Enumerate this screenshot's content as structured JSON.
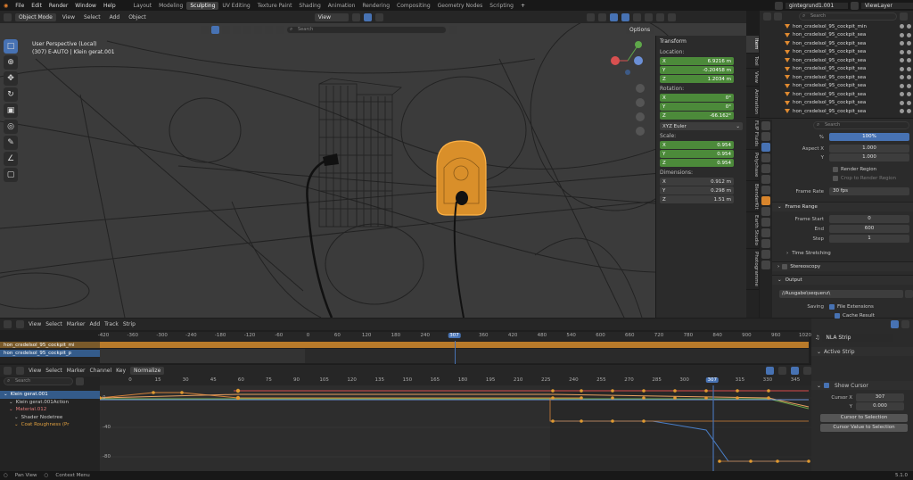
{
  "menu": {
    "items": [
      "File",
      "Edit",
      "Render",
      "Window",
      "Help"
    ],
    "workspaces": [
      "Layout",
      "Modeling",
      "Sculpting",
      "UV Editing",
      "Texture Paint",
      "Shading",
      "Animation",
      "Rendering",
      "Compositing",
      "Geometry Nodes",
      "Scripting"
    ],
    "active_workspace": "Sculpting",
    "scene": "gintegrund1.001",
    "view_layer": "ViewLayer"
  },
  "viewport": {
    "mode": "Object Mode",
    "menus": [
      "View",
      "Select",
      "Add",
      "Object"
    ],
    "orientation": "View",
    "options": "Options",
    "perspective": "User Perspective (Local)",
    "object_info": "(307) E-AUTO | Klein gerat.001",
    "search_placeholder": "Search"
  },
  "transform": {
    "header": "Transform",
    "location_label": "Location:",
    "location": [
      {
        "axis": "X",
        "value": "6.9216 m"
      },
      {
        "axis": "Y",
        "value": "-0.20458 m"
      },
      {
        "axis": "Z",
        "value": "1.2034 m"
      }
    ],
    "rotation_label": "Rotation:",
    "rotation": [
      {
        "axis": "X",
        "value": "0°"
      },
      {
        "axis": "Y",
        "value": "0°"
      },
      {
        "axis": "Z",
        "value": "-66.162°"
      }
    ],
    "rotation_mode": "XYZ Euler",
    "scale_label": "Scale:",
    "scale": [
      {
        "axis": "X",
        "value": "0.954"
      },
      {
        "axis": "Y",
        "value": "0.954"
      },
      {
        "axis": "Z",
        "value": "0.954"
      }
    ],
    "dimensions_label": "Dimensions:",
    "dimensions": [
      {
        "axis": "X",
        "value": "0.912 m"
      },
      {
        "axis": "Y",
        "value": "0.298 m"
      },
      {
        "axis": "Z",
        "value": "1.51 m"
      }
    ]
  },
  "sidebar_tabs": [
    "Item",
    "Tool",
    "View",
    "Animation",
    "FLIP Fluids",
    "Polychase",
    "BlenderKit",
    "Earth Studio",
    "Photogramme"
  ],
  "outliner": {
    "search_placeholder": "Search",
    "items": [
      "hon_crxdelsol_95_cockpit_min",
      "hon_crxdelsol_95_cockpit_sea",
      "hon_crxdelsol_95_cockpit_sea",
      "hon_crxdelsol_95_cockpit_sea",
      "hon_crxdelsol_95_cockpit_sea",
      "hon_crxdelsol_95_cockpit_sea",
      "hon_crxdelsol_95_cockpit_sea",
      "hon_crxdelsol_95_cockpit_sea",
      "hon_crxdelsol_95_cockpit_sea",
      "hon_crxdelsol_95_cockpit_sea",
      "hon_crxdelsol_95_cockpit_sea"
    ]
  },
  "properties": {
    "search_placeholder": "Search",
    "percent_label": "%",
    "percent_value": "100%",
    "aspect_x_label": "Aspect X",
    "aspect_x": "1.000",
    "aspect_y_label": "Y",
    "aspect_y": "1.000",
    "render_region": "Render Region",
    "crop_region": "Crop to Render Region",
    "frame_rate_label": "Frame Rate",
    "frame_rate": "30 fps",
    "frame_range_header": "Frame Range",
    "frame_start_label": "Frame Start",
    "frame_start": "0",
    "end_label": "End",
    "end": "600",
    "step_label": "Step",
    "step": "1",
    "time_stretching": "Time Stretching",
    "stereoscopy": "Stereoscopy",
    "output_header": "Output",
    "output_path": "//Ausgabe\\sequenz\\",
    "saving_label": "Saving",
    "file_extensions": "File Extensions",
    "cache_result": "Cache Result"
  },
  "timeline": {
    "menus": [
      "View",
      "Select",
      "Marker",
      "Add",
      "Track",
      "Strip"
    ],
    "ticks": [
      "-420",
      "-360",
      "-300",
      "-240",
      "-180",
      "-120",
      "-60",
      "0",
      "60",
      "120",
      "180",
      "240",
      "307",
      "360",
      "420",
      "480",
      "540",
      "600",
      "660",
      "720",
      "780",
      "840",
      "900",
      "960",
      "1020"
    ],
    "current_frame": "307",
    "track_name": "hon_crxdelsol_95_cockpit_mi",
    "strip_name": "hon_crxdelsol_95_cockpit_p"
  },
  "nla_sidebar": {
    "strip_field": "NLA Strip",
    "active_strip": "Active Strip"
  },
  "graph_editor": {
    "menus": [
      "View",
      "Select",
      "Marker",
      "Channel",
      "Key"
    ],
    "normalize": "Normalize",
    "search_placeholder": "Search",
    "channels": [
      {
        "name": "Klein gerat.001",
        "level": 0,
        "selected": true
      },
      {
        "name": "Klein gerat.001Action",
        "level": 1,
        "selected": false
      },
      {
        "name": "Material.012",
        "level": 1,
        "selected": false
      },
      {
        "name": "Shader Nodetree",
        "level": 2,
        "selected": false
      },
      {
        "name": "Coat Roughness (Pr",
        "level": 2,
        "selected": false
      }
    ],
    "ticks": [
      "0",
      "15",
      "30",
      "45",
      "60",
      "75",
      "90",
      "105",
      "120",
      "135",
      "150",
      "165",
      "180",
      "195",
      "210",
      "225",
      "240",
      "255",
      "270",
      "285",
      "300",
      "307",
      "315",
      "330",
      "345"
    ],
    "y_labels": [
      "0",
      "-40",
      "-80"
    ],
    "current_frame": "307"
  },
  "graph_sidebar": {
    "show_cursor": "Show Cursor",
    "cursor_x_label": "Cursor X",
    "cursor_x": "307",
    "cursor_y_label": "Y",
    "cursor_y": "0.000",
    "cursor_to_selection": "Cursor to Selection",
    "cursor_value_to_selection": "Cursor Value to Selection"
  },
  "status": {
    "pan_view": "Pan View",
    "context_menu": "Context Menu",
    "version": "5.1.0"
  }
}
